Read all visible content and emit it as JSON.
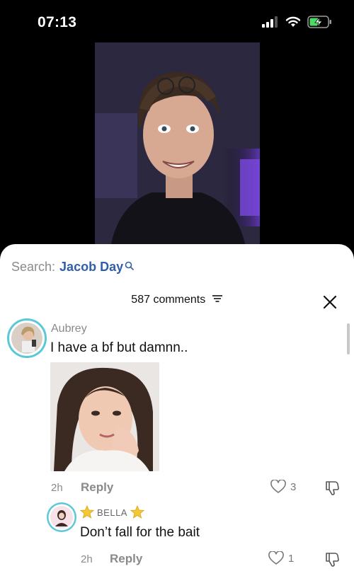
{
  "status_bar": {
    "time": "07:13",
    "battery_icon": "battery-charging-icon",
    "wifi_icon": "wifi-icon",
    "signal_icon": "cellular-signal-icon"
  },
  "search": {
    "label": "Search:",
    "term": "Jacob Day"
  },
  "comments": {
    "count_label": "587 comments",
    "filter_icon": "filter-icon",
    "close_icon": "close-icon",
    "items": [
      {
        "username": "Aubrey",
        "text": "I have a bf but damnn..",
        "time": "2h",
        "reply_label": "Reply",
        "likes": "3"
      },
      {
        "username": "BELLA",
        "text": "Don’t fall for the bait",
        "time": "2h",
        "reply_label": "Reply",
        "likes": "1"
      }
    ]
  },
  "colors": {
    "search_term": "#2f5fa8",
    "avatar_ring": "#5bc8d8",
    "star": "#f3c735"
  }
}
